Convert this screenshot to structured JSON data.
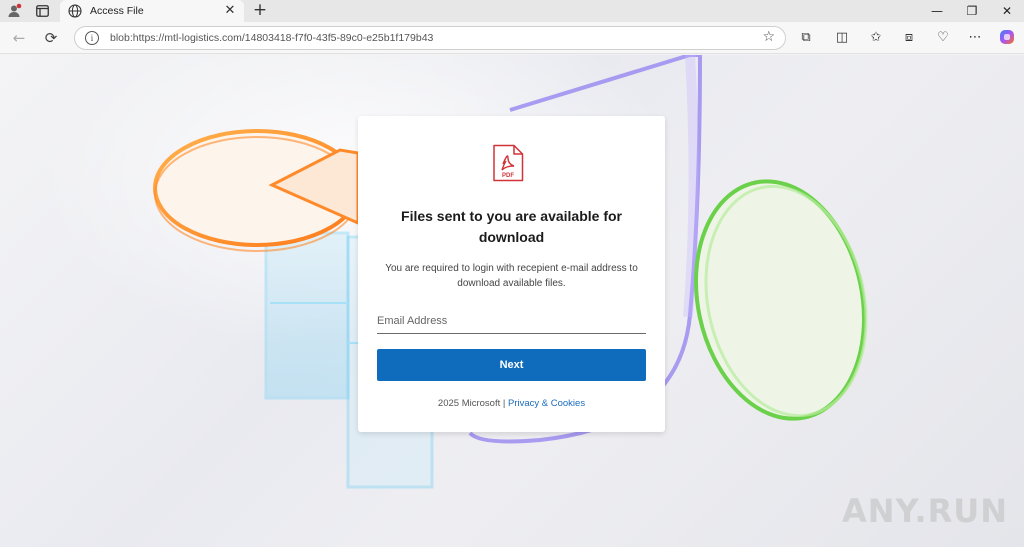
{
  "browser": {
    "tab_title": "Access File",
    "url": "blob:https://mtl-logistics.com/14803418-f7f0-43f5-89c0-e25b1f179b43"
  },
  "card": {
    "icon_label": "PDF",
    "title": "Files sent to you are available for download",
    "subtitle": "You are required to login with recepient e-mail address to download available files.",
    "email_placeholder": "Email Address",
    "next_label": "Next",
    "footer_copyright": "2025 Microsoft |",
    "footer_link": "Privacy & Cookies"
  },
  "watermark": "ANY.RUN",
  "colors": {
    "accent": "#0f6cbd",
    "link": "#1a6bbd",
    "pdf_red": "#d13438"
  }
}
